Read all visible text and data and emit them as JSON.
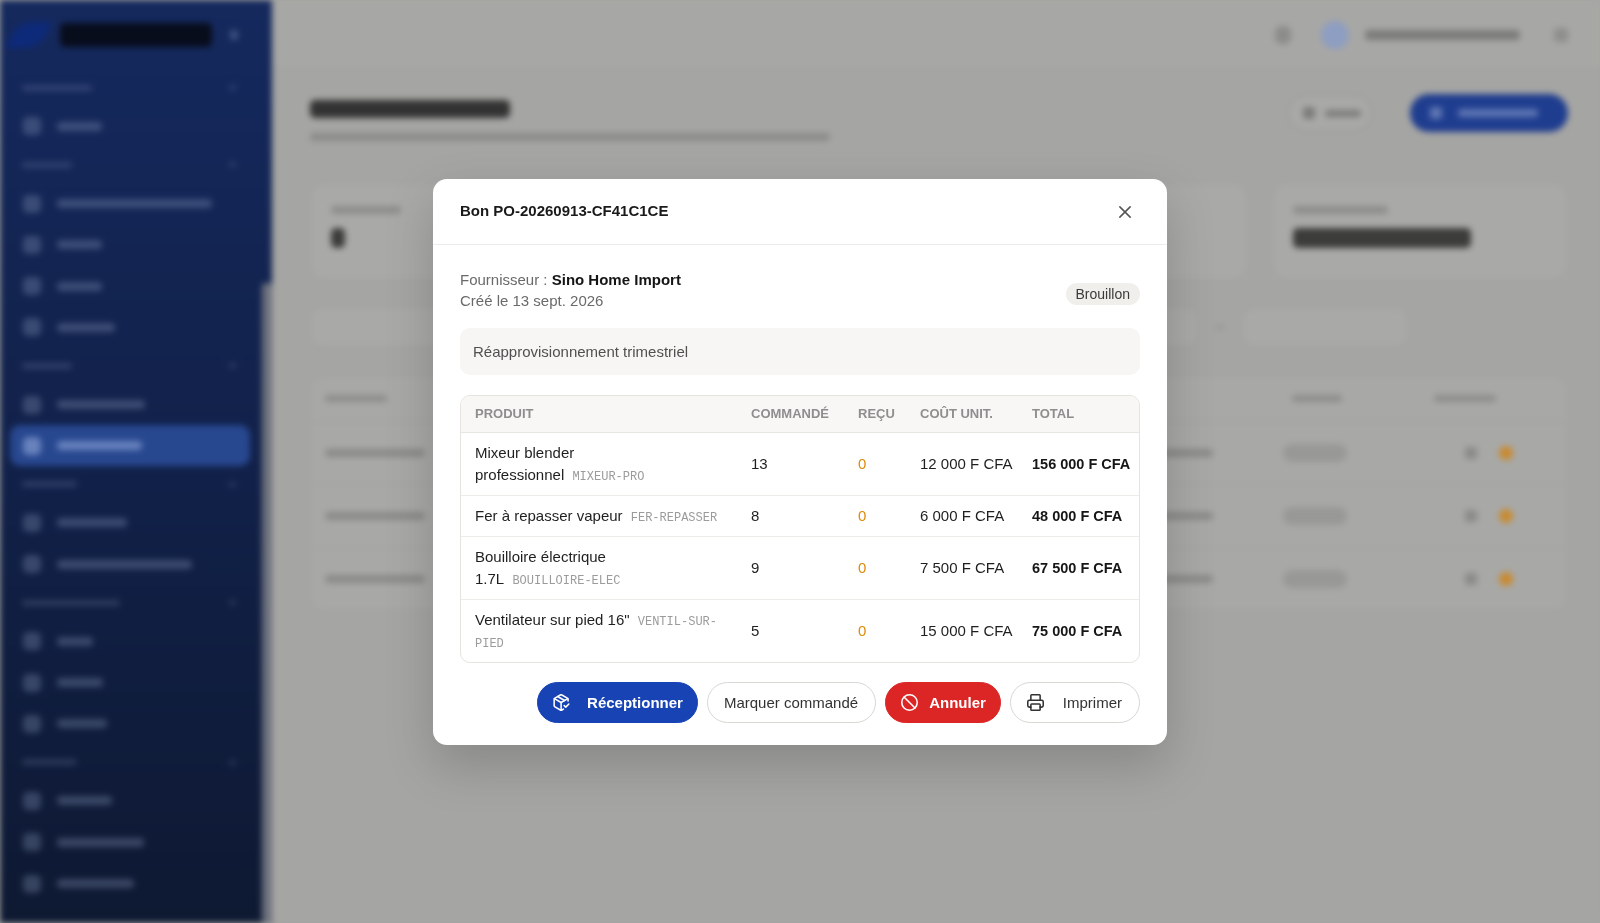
{
  "dialog": {
    "title": "Bon PO-20260913-CF41C1CE",
    "supplier": "Fournisseur : **Sino Home Import**",
    "created": "Créé le 13 sept. 2026",
    "status_badge": "Brouillon",
    "note": "Réapprovisionnement trimestriel",
    "table": {
      "columns": [
        "PRODUIT",
        "COMMANDÉ",
        "REÇU",
        "COÛT UNIT.",
        "TOTAL"
      ],
      "rows": [
        {
          "product": "Mixeur blender professionnel",
          "sku": "MIXEUR-PRO",
          "ordered": "13",
          "received": "0",
          "unit_cost": "12 000 F CFA",
          "total": "156 000 F CFA"
        },
        {
          "product": "Fer à repasser vapeur",
          "sku": "FER-REPASSER",
          "ordered": "8",
          "received": "0",
          "unit_cost": "6 000 F CFA",
          "total": "48 000 F CFA"
        },
        {
          "product": "Bouilloire électrique 1.7L",
          "sku": "BOUILLOIRE-ELEC",
          "ordered": "9",
          "received": "0",
          "unit_cost": "7 500 F CFA",
          "total": "67 500 F CFA"
        },
        {
          "product": "Ventilateur sur pied 16\"",
          "sku": "VENTIL-SUR-PIED",
          "ordered": "5",
          "received": "0",
          "unit_cost": "15 000 F CFA",
          "total": "75 000 F CFA"
        }
      ]
    },
    "actions": [
      {
        "label": "Réceptionner",
        "kind": "primary"
      },
      {
        "label": "Marquer commandé",
        "kind": "outline"
      },
      {
        "label": "Annuler",
        "kind": "danger"
      },
      {
        "label": "Imprimer",
        "kind": "outline"
      }
    ]
  }
}
